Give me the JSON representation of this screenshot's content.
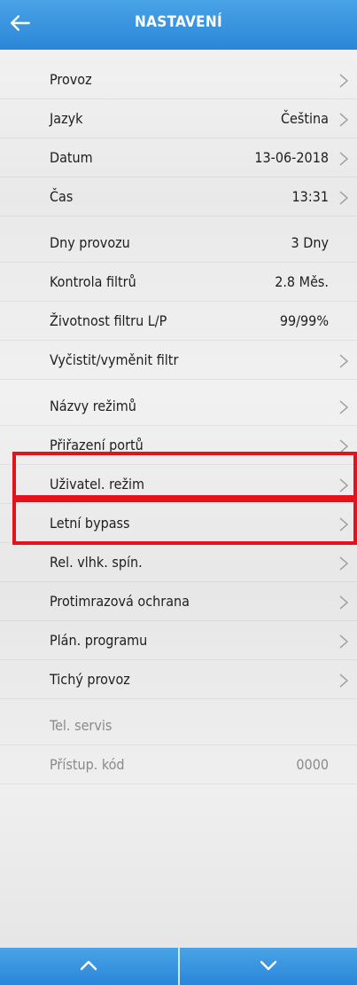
{
  "header": {
    "title": "NASTAVENÍ",
    "back_icon": "arrow-left-icon",
    "color": "#2a86d8"
  },
  "rows": [
    {
      "label": "Provoz",
      "value": "",
      "chevron": true
    },
    {
      "label": "Jazyk",
      "value": "Čeština",
      "chevron": true
    },
    {
      "label": "Datum",
      "value": "13-06-2018",
      "chevron": true
    },
    {
      "label": "Čas",
      "value": "13:31",
      "chevron": true
    },
    {
      "label": "Dny provozu",
      "value": "3 Dny",
      "chevron": false
    },
    {
      "label": "Kontrola filtrů",
      "value": "2.8 Měs.",
      "chevron": false
    },
    {
      "label": "Životnost filtru L/P",
      "value": "99/99%",
      "chevron": false
    },
    {
      "label": "Vyčistit/vyměnit filtr",
      "value": "",
      "chevron": true
    },
    {
      "label": "Názvy režimů",
      "value": "",
      "chevron": true
    },
    {
      "label": "Přiřazení portů",
      "value": "",
      "chevron": true,
      "highlighted": true
    },
    {
      "label": "Uživatel. režim",
      "value": "",
      "chevron": true,
      "highlighted": true
    },
    {
      "label": "Letní bypass",
      "value": "",
      "chevron": true
    },
    {
      "label": "Rel. vlhk. spín.",
      "value": "",
      "chevron": true
    },
    {
      "label": "Protimrazová ochrana",
      "value": "",
      "chevron": true
    },
    {
      "label": "Plán. programu",
      "value": "",
      "chevron": true
    },
    {
      "label": "Tichý provoz",
      "value": "",
      "chevron": true
    },
    {
      "label": "Tel. servis",
      "value": "",
      "chevron": false,
      "disabled": true
    },
    {
      "label": "Přístup. kód",
      "value": "0000",
      "chevron": false,
      "disabled": true
    }
  ],
  "footer": {
    "up_icon": "chevron-up-icon",
    "down_icon": "chevron-down-icon"
  },
  "highlight_color": "#e3121c"
}
